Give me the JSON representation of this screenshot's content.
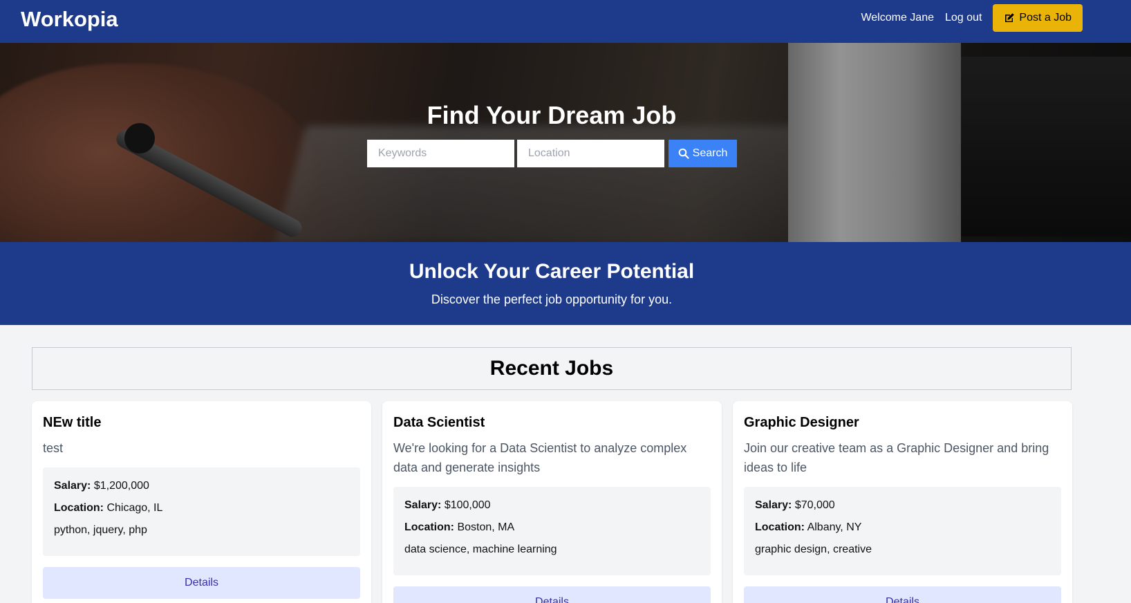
{
  "header": {
    "brand": "Workopia",
    "welcome": "Welcome Jane",
    "logout": "Log out",
    "post_job": "Post a Job"
  },
  "hero": {
    "title": "Find Your Dream Job",
    "keywords_placeholder": "Keywords",
    "location_placeholder": "Location",
    "search_label": "Search"
  },
  "banner": {
    "title": "Unlock Your Career Potential",
    "subtitle": "Discover the perfect job opportunity for you."
  },
  "recent": {
    "title": "Recent Jobs",
    "salary_label": "Salary:",
    "location_label": "Location:",
    "details_label": "Details",
    "jobs": [
      {
        "title": "NEw title",
        "description": "test",
        "salary": "$1,200,000",
        "location": "Chicago, IL",
        "tags": "python, jquery, php"
      },
      {
        "title": "Data Scientist",
        "description": "We're looking for a Data Scientist to analyze complex data and generate insights",
        "salary": "$100,000",
        "location": "Boston, MA",
        "tags": "data science, machine learning"
      },
      {
        "title": "Graphic Designer",
        "description": "Join our creative team as a Graphic Designer and bring ideas to life",
        "salary": "$70,000",
        "location": "Albany, NY",
        "tags": "graphic design, creative"
      }
    ]
  },
  "colors": {
    "nav_bg": "#1e3a8a",
    "accent_yellow": "#eab308",
    "search_blue": "#3b82f6",
    "details_bg": "#e0e7ff"
  }
}
